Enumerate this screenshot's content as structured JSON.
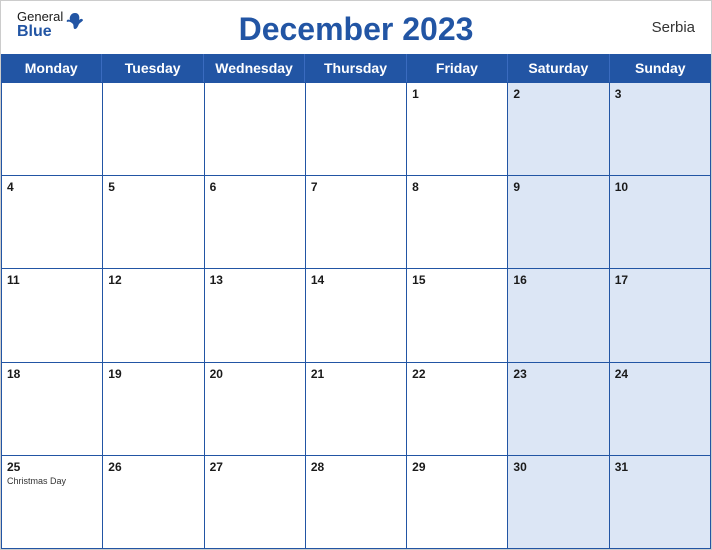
{
  "header": {
    "logo_general": "General",
    "logo_blue": "Blue",
    "title": "December 2023",
    "country": "Serbia"
  },
  "day_headers": [
    "Monday",
    "Tuesday",
    "Wednesday",
    "Thursday",
    "Friday",
    "Saturday",
    "Sunday"
  ],
  "weeks": [
    [
      {
        "num": "",
        "holiday": "",
        "shaded": false
      },
      {
        "num": "",
        "holiday": "",
        "shaded": false
      },
      {
        "num": "",
        "holiday": "",
        "shaded": false
      },
      {
        "num": "",
        "holiday": "",
        "shaded": false
      },
      {
        "num": "1",
        "holiday": "",
        "shaded": false
      },
      {
        "num": "2",
        "holiday": "",
        "shaded": true
      },
      {
        "num": "3",
        "holiday": "",
        "shaded": true
      }
    ],
    [
      {
        "num": "4",
        "holiday": "",
        "shaded": false
      },
      {
        "num": "5",
        "holiday": "",
        "shaded": false
      },
      {
        "num": "6",
        "holiday": "",
        "shaded": false
      },
      {
        "num": "7",
        "holiday": "",
        "shaded": false
      },
      {
        "num": "8",
        "holiday": "",
        "shaded": false
      },
      {
        "num": "9",
        "holiday": "",
        "shaded": true
      },
      {
        "num": "10",
        "holiday": "",
        "shaded": true
      }
    ],
    [
      {
        "num": "11",
        "holiday": "",
        "shaded": false
      },
      {
        "num": "12",
        "holiday": "",
        "shaded": false
      },
      {
        "num": "13",
        "holiday": "",
        "shaded": false
      },
      {
        "num": "14",
        "holiday": "",
        "shaded": false
      },
      {
        "num": "15",
        "holiday": "",
        "shaded": false
      },
      {
        "num": "16",
        "holiday": "",
        "shaded": true
      },
      {
        "num": "17",
        "holiday": "",
        "shaded": true
      }
    ],
    [
      {
        "num": "18",
        "holiday": "",
        "shaded": false
      },
      {
        "num": "19",
        "holiday": "",
        "shaded": false
      },
      {
        "num": "20",
        "holiday": "",
        "shaded": false
      },
      {
        "num": "21",
        "holiday": "",
        "shaded": false
      },
      {
        "num": "22",
        "holiday": "",
        "shaded": false
      },
      {
        "num": "23",
        "holiday": "",
        "shaded": true
      },
      {
        "num": "24",
        "holiday": "",
        "shaded": true
      }
    ],
    [
      {
        "num": "25",
        "holiday": "Christmas Day",
        "shaded": false
      },
      {
        "num": "26",
        "holiday": "",
        "shaded": false
      },
      {
        "num": "27",
        "holiday": "",
        "shaded": false
      },
      {
        "num": "28",
        "holiday": "",
        "shaded": false
      },
      {
        "num": "29",
        "holiday": "",
        "shaded": false
      },
      {
        "num": "30",
        "holiday": "",
        "shaded": true
      },
      {
        "num": "31",
        "holiday": "",
        "shaded": true
      }
    ]
  ]
}
